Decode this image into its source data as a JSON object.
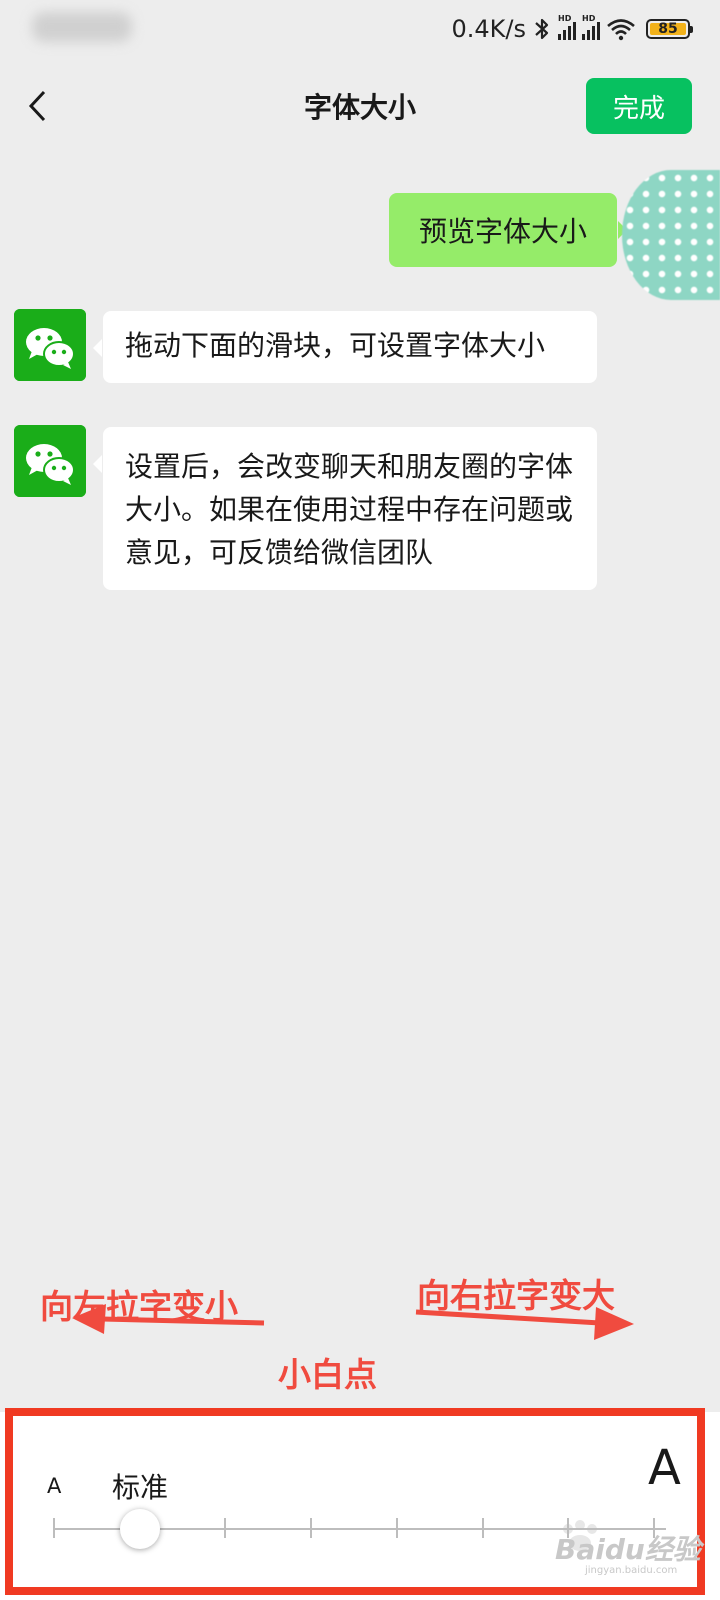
{
  "status_bar": {
    "net_speed": "0.4K/s",
    "signal_tag": "HD",
    "battery_level": "85",
    "icons": [
      "bluetooth-icon",
      "signal-icon",
      "signal-icon",
      "wifi-icon",
      "battery-icon"
    ]
  },
  "nav": {
    "back_icon": "chevron-left-icon",
    "title": "字体大小",
    "done_label": "完成"
  },
  "chat": {
    "me_message": "预览字体大小",
    "bot_messages": [
      "拖动下面的滑块，可设置字体大小",
      "设置后，会改变聊天和朋友圈的字体大小。如果在使用过程中存在问题或意见，可反馈给微信团队"
    ],
    "bot_avatar_icon": "wechat-logo-icon"
  },
  "annotations": {
    "left": "向左拉字变小",
    "right": "向右拉字变大",
    "dot": "小白点",
    "color": "#f04b3f"
  },
  "font_panel": {
    "small_label": "A",
    "large_label": "A",
    "current_level": "标准",
    "steps": 8,
    "selected_step": 1
  },
  "watermark": {
    "text": "Bai",
    "suffix": "du",
    "cn": "经验",
    "sub": "jingyan.baidu.com"
  },
  "colors": {
    "accent": "#07c160",
    "bubble_me": "#95ec69",
    "background": "#ededed",
    "frame": "#f03a22"
  }
}
